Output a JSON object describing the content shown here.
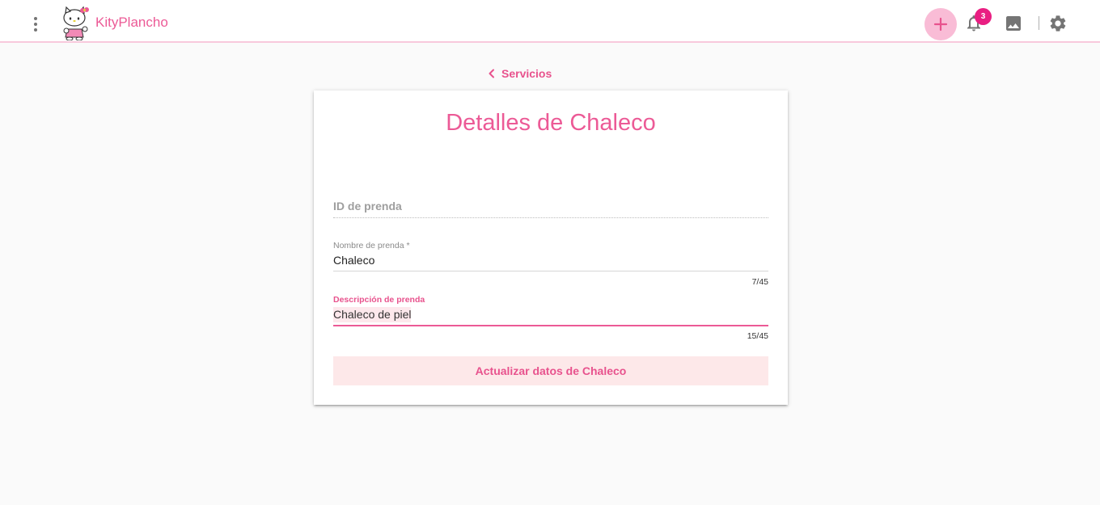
{
  "header": {
    "app_name": "KityPlancho",
    "notification_count": "3",
    "icons": {
      "menu": "more-vert-icon",
      "logo": "hello-kitty-logo",
      "add": "plus-icon",
      "notifications": "bell-icon",
      "gallery": "image-icon",
      "settings": "gear-icon"
    },
    "colors": {
      "accent": "#ec5a96",
      "add_bg": "#f9bcd6",
      "badge": "#e91e82",
      "bar_border": "#f8c9dc"
    }
  },
  "breadcrumb": {
    "back_label": "Servicios",
    "icon": "chevron-left-icon"
  },
  "form": {
    "title": "Detalles de Chaleco",
    "id_field": {
      "placeholder": "ID de prenda",
      "value": ""
    },
    "name_field": {
      "label": "Nombre de prenda *",
      "value": "Chaleco",
      "counter": "7/45"
    },
    "desc_field": {
      "label": "Descripción de prenda",
      "value": "Chaleco de piel",
      "counter": "15/45"
    },
    "submit_label": "Actualizar datos de Chaleco"
  }
}
